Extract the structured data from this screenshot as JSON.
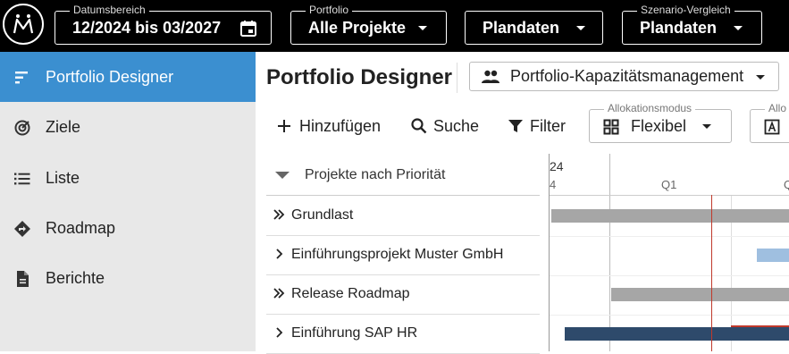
{
  "header": {
    "date_range": {
      "legend": "Datumsbereich",
      "value": "12/2024 bis 03/2027"
    },
    "portfolio": {
      "legend": "Portfolio",
      "value": "Alle Projekte"
    },
    "dataset": {
      "value": "Plandaten"
    },
    "scenario": {
      "legend": "Szenario-Vergleich",
      "value": "Plandaten"
    }
  },
  "sidebar": {
    "items": [
      {
        "label": "Portfolio Designer",
        "icon": "portfolio-designer-icon",
        "active": true
      },
      {
        "label": "Ziele",
        "icon": "target-icon"
      },
      {
        "label": "Liste",
        "icon": "list-icon"
      },
      {
        "label": "Roadmap",
        "icon": "roadmap-icon"
      },
      {
        "label": "Berichte",
        "icon": "report-icon"
      }
    ]
  },
  "main": {
    "title": "Portfolio Designer",
    "portfolio_select": "Portfolio-Kapazitätsmanagement",
    "toolbar": {
      "add_label": "Hinzufügen",
      "search_label": "Suche",
      "filter_label": "Filter",
      "alloc_mode": {
        "legend": "Allokationsmodus",
        "value": "Flexibel"
      },
      "alloc_cut_legend": "Allo"
    },
    "list": {
      "header": "Projekte nach Priorität",
      "rows": [
        {
          "label": "Grundlast",
          "chevron": "double"
        },
        {
          "label": "Einführungsprojekt Muster GmbH",
          "chevron": "single"
        },
        {
          "label": "Release Roadmap",
          "chevron": "double"
        },
        {
          "label": "Einführung SAP HR",
          "chevron": "single"
        }
      ]
    },
    "gantt": {
      "year_label": "24",
      "year_tick": "4",
      "quarters": [
        "Q1",
        "Q"
      ],
      "colors": {
        "gray": "#a6a6a6",
        "light_blue": "#9fbfe0",
        "navy": "#2e4a6b",
        "today": "#c0392b"
      }
    }
  }
}
